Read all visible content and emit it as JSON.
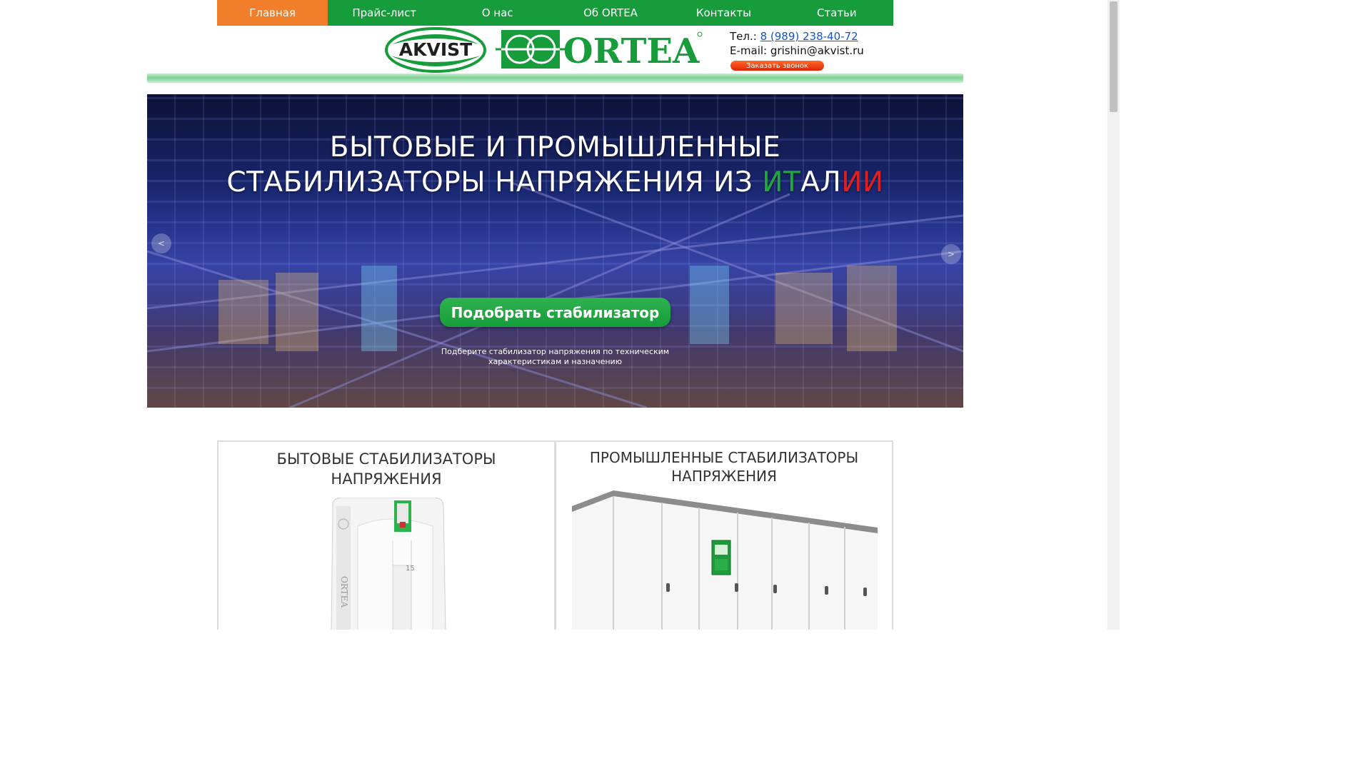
{
  "nav": {
    "items": [
      {
        "label": "Главная",
        "active": true
      },
      {
        "label": "Прайс-лист"
      },
      {
        "label": "О нас"
      },
      {
        "label": "Об ORTEA"
      },
      {
        "label": "Контакты"
      },
      {
        "label": "Статьи"
      }
    ],
    "accent_color": "#f07e2a",
    "bar_color": "#169c3a"
  },
  "header": {
    "logo_akvist_text": "AKVIST",
    "logo_ortea_text": "ORTEA",
    "phone_label": "Тел.:",
    "phone": "8 (989) 238-40-72",
    "email_label": "E-mail:",
    "email": "grishin@akvist.ru",
    "callback_label": "Заказать звонок"
  },
  "hero": {
    "title_line1": "БЫТОВЫЕ И ПРОМЫШЛЕННЫЕ",
    "title_line2_main": "СТАБИЛИЗАТОРЫ НАПРЯЖЕНИЯ ИЗ ",
    "title_it_green": "ИТ",
    "title_al_white": "АЛ",
    "title_ii_red": "ИИ",
    "cta_label": "Подобрать стабилизатор",
    "subtitle": "Подберите стабилизатор напряжения по техническим характеристикам и назначению",
    "prev_icon": "<",
    "next_icon": ">"
  },
  "cards": {
    "household_title_line1": "БЫТОВЫЕ СТАБИЛИЗАТОРЫ",
    "household_title_line2": "НАПРЯЖЕНИЯ",
    "household_product_label": "ORTEA",
    "household_model_number": "15",
    "industrial_title_line1": "ПРОМЫШЛЕННЫЕ СТАБИЛИЗАТОРЫ",
    "industrial_title_line2": "НАПРЯЖЕНИЯ"
  }
}
